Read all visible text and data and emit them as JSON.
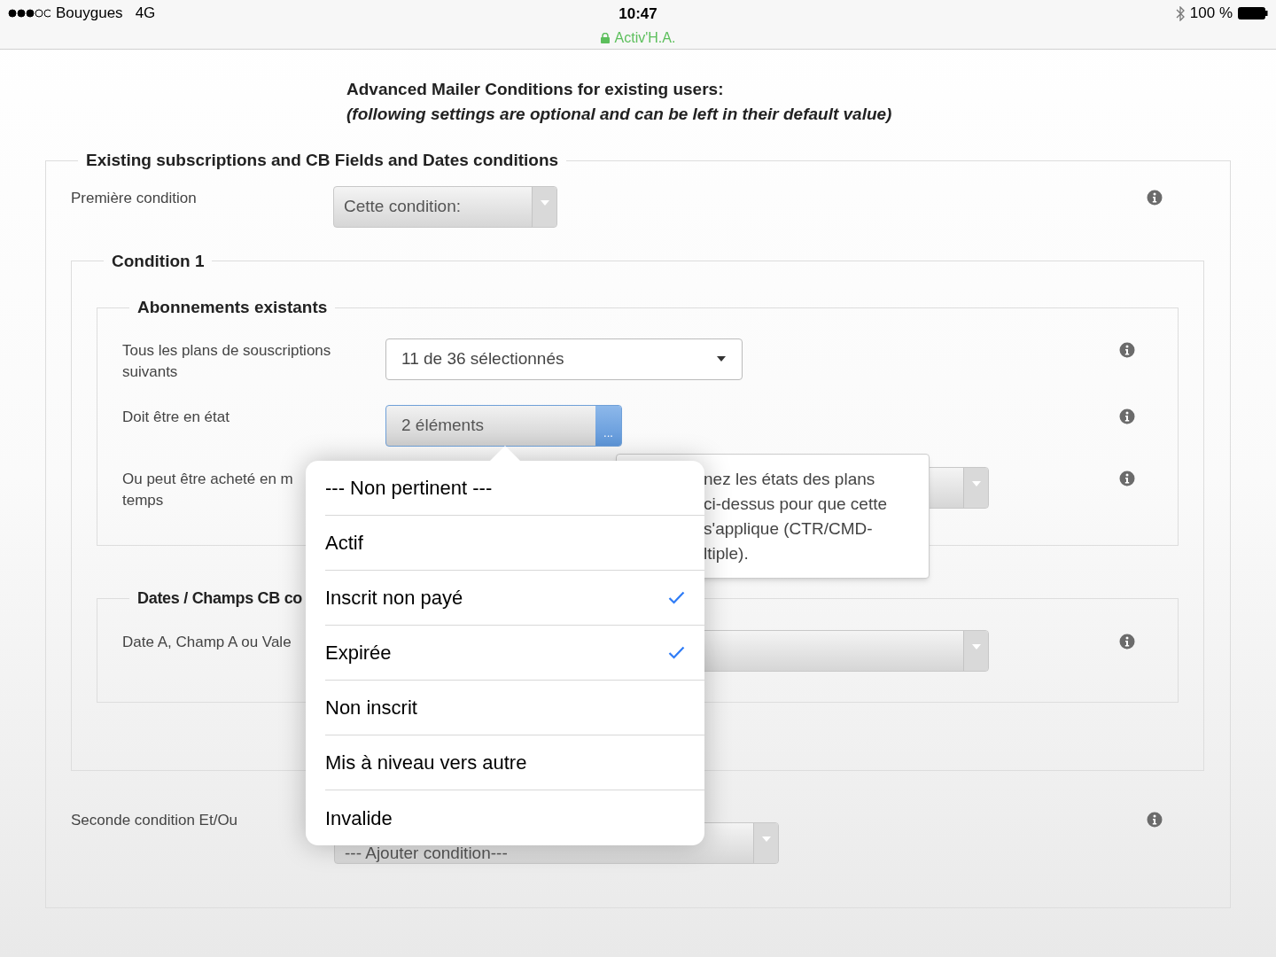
{
  "status_bar": {
    "carrier": "Bouygues",
    "network": "4G",
    "time": "10:47",
    "site": "Activ'H.A.",
    "battery": "100 %"
  },
  "intro": {
    "title": "Advanced Mailer Conditions for existing users:",
    "subtitle": "(following settings are optional and can be left in their default value)"
  },
  "section": {
    "legend": "Existing subscriptions and CB Fields and Dates conditions",
    "first_condition": {
      "label": "Première condition",
      "value": "Cette condition:"
    },
    "condition": {
      "legend": "Condition 1",
      "subscriptions": {
        "legend": "Abonnements existants",
        "rows": [
          {
            "kind": "native",
            "label": "Tous les plans de souscriptions suivants",
            "value": "11 de 36 sélectionnés"
          },
          {
            "kind": "multi",
            "label": "Doit être en état",
            "value": "2 éléments",
            "button": "..."
          },
          {
            "kind": "blank",
            "label": "Ou peut être acheté en m",
            "label_line2": "temps"
          }
        ]
      },
      "dates": {
        "legend": "Dates / Champs CB co",
        "rows": [
          {
            "kind": "blank",
            "label": "Date A, Champ A ou Vale"
          }
        ]
      }
    },
    "second_condition": {
      "label": "Seconde condition Et/Ou",
      "value": "--- Ajouter condition---"
    }
  },
  "tooltip": {
    "lines": [
      "nez les états des plans",
      "ci-dessus pour que cette",
      "s'applique (CTR/CMD-",
      "ltiple)."
    ]
  },
  "popover": {
    "options": [
      {
        "label": "--- Non pertinent ---",
        "selected": false
      },
      {
        "label": "Actif",
        "selected": false
      },
      {
        "label": "Inscrit non payé",
        "selected": true
      },
      {
        "label": "Expirée",
        "selected": true
      },
      {
        "label": "Non inscrit",
        "selected": false
      },
      {
        "label": "Mis à niveau vers autre",
        "selected": false
      },
      {
        "label": "Invalide",
        "selected": false
      }
    ]
  }
}
